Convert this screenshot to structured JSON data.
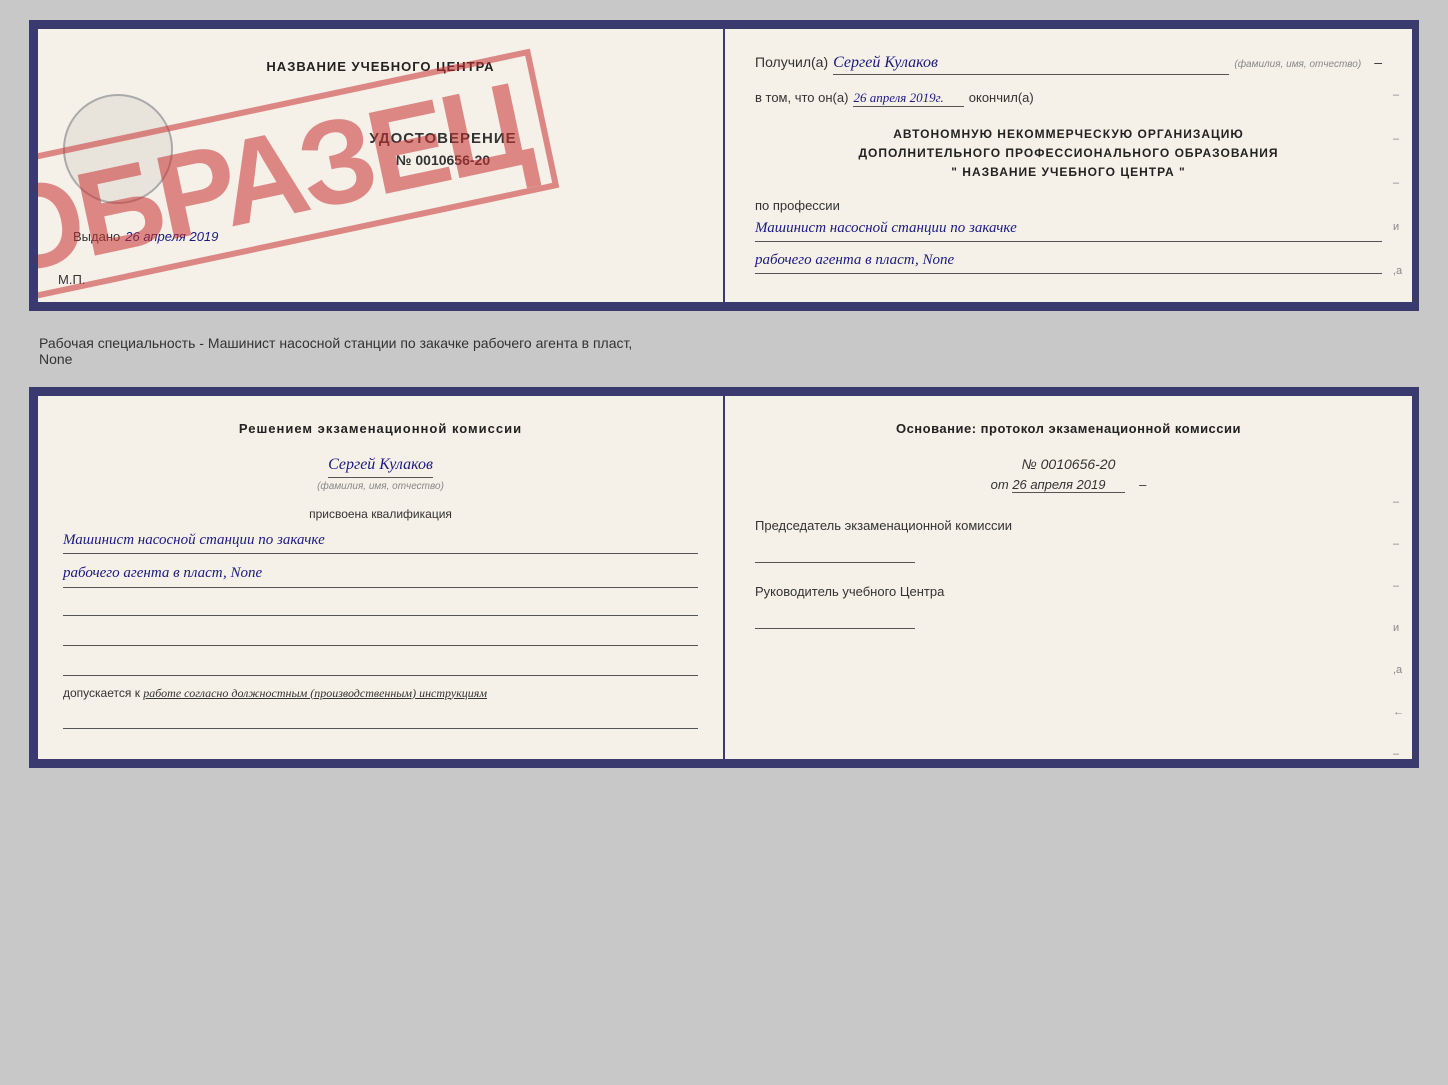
{
  "page": {
    "background": "#c8c8c8"
  },
  "top_document": {
    "left": {
      "center_name": "НАЗВАНИЕ УЧЕБНОГО ЦЕНТРА",
      "cert_title": "УДОСТОВЕРЕНИЕ",
      "cert_number": "№ 0010656-20",
      "stamp_circle_label": "",
      "obrazec_label": "ОБРАЗЕЦ",
      "issued_prefix": "Выдано",
      "issued_date": "26 апреля 2019",
      "mp_label": "М.П."
    },
    "right": {
      "recipient_prefix": "Получил(а)",
      "recipient_name": "Сергей Кулаков",
      "recipient_hint": "(фамилия, имя, отчество)",
      "date_prefix": "в том, что он(а)",
      "date_value": "26 апреля 2019г.",
      "date_suffix": "окончил(а)",
      "org_line1": "АВТОНОМНУЮ НЕКОММЕРЧЕСКУЮ ОРГАНИЗАЦИЮ",
      "org_line2": "ДОПОЛНИТЕЛЬНОГО ПРОФЕССИОНАЛЬНОГО ОБРАЗОВАНИЯ",
      "org_line3": "\" НАЗВАНИЕ УЧЕБНОГО ЦЕНТРА \"",
      "profession_label": "по профессии",
      "profession_line1": "Машинист насосной станции по закачке",
      "profession_line2": "рабочего агента в пласт, None",
      "side_chars": [
        "–",
        "–",
        "–",
        "и",
        ",а",
        "←",
        "–",
        "–",
        "–"
      ]
    }
  },
  "middle_text": {
    "line1": "Рабочая специальность - Машинист насосной станции по закачке рабочего агента в пласт,",
    "line2": "None"
  },
  "bottom_document": {
    "left": {
      "decision_title": "Решением экзаменационной комиссии",
      "person_name": "Сергей Кулаков",
      "person_hint": "(фамилия, имя, отчество)",
      "assigned_label": "присвоена квалификация",
      "qualification_line1": "Машинист насосной станции по закачке",
      "qualification_line2": "рабочего агента в пласт, None",
      "blank_lines": [
        "",
        "",
        ""
      ],
      "admitted_prefix": "допускается к",
      "admitted_value": "работе согласно должностным (производственным) инструкциям"
    },
    "right": {
      "basis_title": "Основание: протокол экзаменационной комиссии",
      "protocol_number": "№ 0010656-20",
      "protocol_date_prefix": "от",
      "protocol_date": "26 апреля 2019",
      "chairman_label": "Председатель экзаменационной комиссии",
      "director_label": "Руководитель учебного Центра",
      "side_chars": [
        "–",
        "–",
        "–",
        "и",
        ",а",
        "←",
        "–",
        "–",
        "–"
      ]
    }
  }
}
